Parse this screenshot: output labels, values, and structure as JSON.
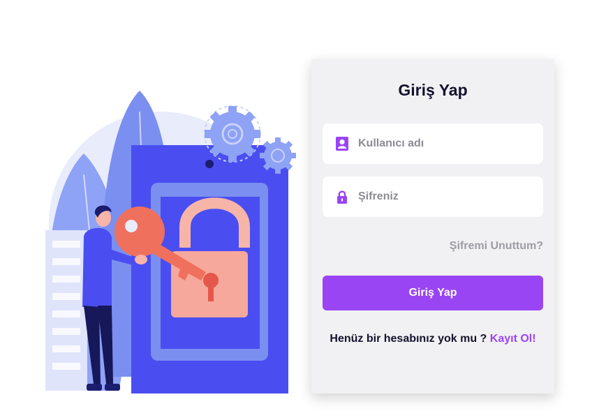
{
  "login": {
    "title": "Giriş Yap",
    "username_placeholder": "Kullanıcı adı",
    "password_placeholder": "Şifreniz",
    "forgot_link": "Şifremi Unuttum?",
    "submit_label": "Giriş Yap",
    "no_account_text": "Henüz bir hesabınız yok mu ?",
    "signup_link": "Kayıt Ol!"
  },
  "colors": {
    "accent": "#9a45f4",
    "card_bg": "#f1f1f3",
    "illustration_blue": "#4a4ef0"
  },
  "icons": {
    "username": "user-icon",
    "password": "lock-icon"
  }
}
